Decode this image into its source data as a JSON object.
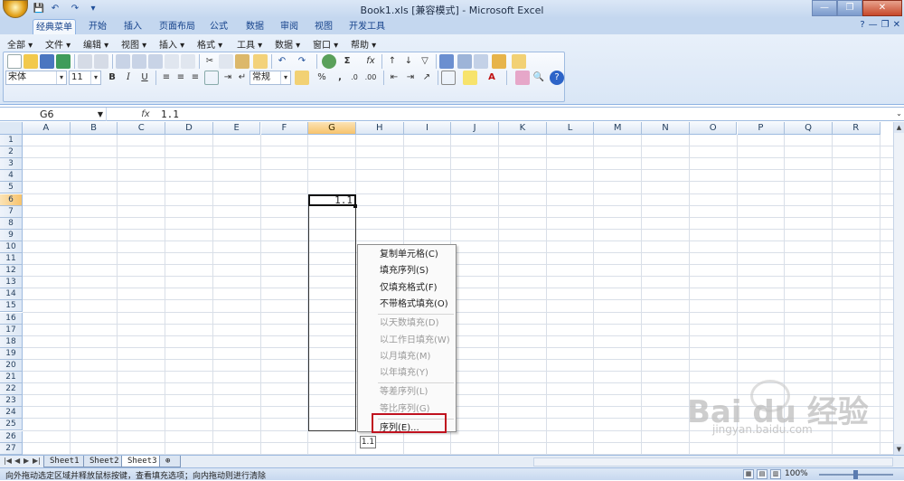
{
  "window": {
    "title": "Book1.xls  [兼容模式] - Microsoft Excel",
    "controls": [
      "—",
      "❐",
      "✕"
    ]
  },
  "quick_access": [
    "💾",
    "↶",
    "↷",
    "▾"
  ],
  "ribbon_tabs": [
    "经典菜单",
    "开始",
    "插入",
    "页面布局",
    "公式",
    "数据",
    "审阅",
    "视图",
    "开发工具"
  ],
  "ribbon_tab_active": "经典菜单",
  "ribbon_right_icons": [
    "?",
    "—",
    "❐",
    "✕"
  ],
  "menus": [
    "全部 ▾",
    "文件 ▾",
    "编辑 ▾",
    "视图 ▾",
    "插入 ▾",
    "格式 ▾",
    "工具 ▾",
    "数据 ▾",
    "窗口 ▾",
    "帮助 ▾"
  ],
  "toolbar": {
    "font_name": "宋体",
    "font_size": "11",
    "number_format": "常规",
    "bold": "B",
    "italic": "I",
    "underline": "U",
    "sum": "Σ",
    "fx": "fx",
    "percent": "%",
    "comma": ","
  },
  "formula_bar": {
    "name_box": "G6",
    "fx_label": "fx",
    "value": "1.1"
  },
  "columns": [
    "A",
    "B",
    "C",
    "D",
    "E",
    "F",
    "G",
    "H",
    "I",
    "J",
    "K",
    "L",
    "M",
    "N",
    "O",
    "P",
    "Q",
    "R"
  ],
  "selected_column": "G",
  "rows": [
    "1",
    "2",
    "3",
    "4",
    "5",
    "6",
    "7",
    "8",
    "9",
    "10",
    "11",
    "12",
    "13",
    "14",
    "15",
    "16",
    "17",
    "18",
    "19",
    "20",
    "21",
    "22",
    "23",
    "24",
    "25",
    "26",
    "27"
  ],
  "selected_row": "6",
  "active_cell_value": "1.1",
  "context_menu": {
    "items": [
      {
        "label": "复制单元格(C)",
        "enabled": true
      },
      {
        "label": "填充序列(S)",
        "enabled": true
      },
      {
        "label": "仅填充格式(F)",
        "enabled": true
      },
      {
        "label": "不带格式填充(O)",
        "enabled": true
      },
      {
        "label": "以天数填充(D)",
        "enabled": false
      },
      {
        "label": "以工作日填充(W)",
        "enabled": false
      },
      {
        "label": "以月填充(M)",
        "enabled": false
      },
      {
        "label": "以年填充(Y)",
        "enabled": false
      },
      {
        "label": "等差序列(L)",
        "enabled": false
      },
      {
        "label": "等比序列(G)",
        "enabled": false
      },
      {
        "label": "序列(E)...",
        "enabled": true
      }
    ]
  },
  "tooltip": "1.1",
  "sheets": [
    "Sheet1",
    "Sheet2",
    "Sheet3"
  ],
  "active_sheet": "Sheet3",
  "status_text": "向外拖动选定区域并释放鼠标按键，查看填充选项；向内拖动则进行清除",
  "zoom": "100%",
  "watermark": {
    "brand": "Bai du 经验",
    "url": "jingyan.baidu.com"
  }
}
